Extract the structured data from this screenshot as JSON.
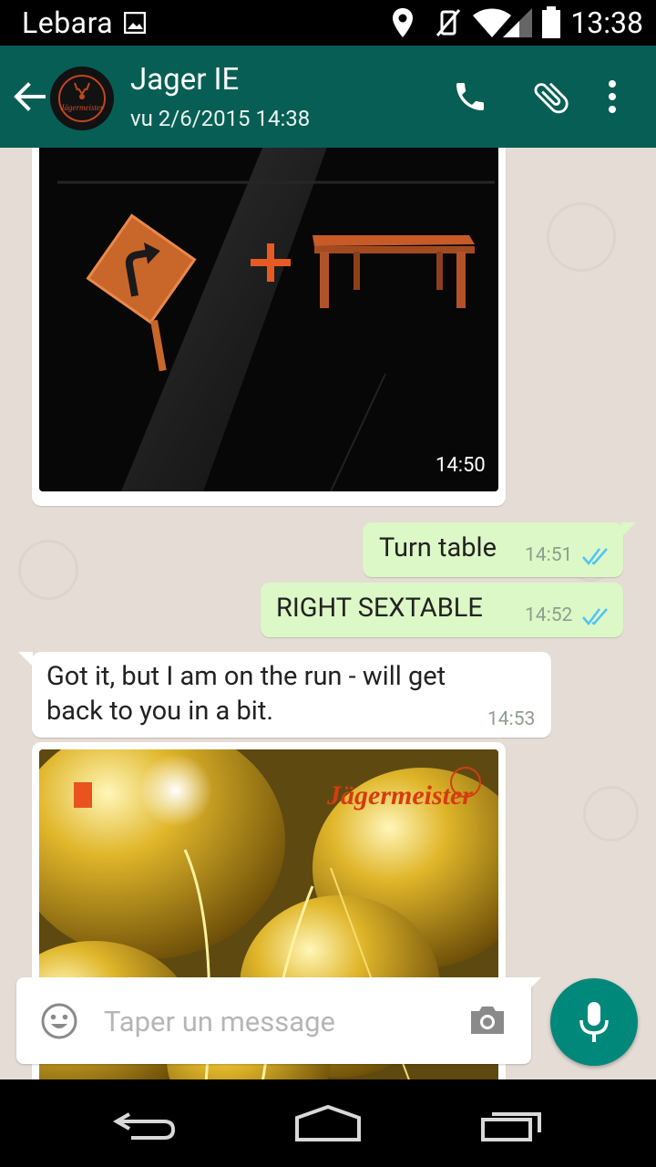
{
  "status_bar": {
    "carrier": "Lebara",
    "time": "13:38",
    "icons": [
      "image-notification-icon",
      "location-icon",
      "vibrate-mute-icon",
      "wifi-icon",
      "signal-icon",
      "battery-icon"
    ]
  },
  "header": {
    "contact_name": "Jager IE",
    "last_seen": "vu 2/6/2015 14:38",
    "avatar_text": "Jägermeister",
    "icons": [
      "back-arrow-icon",
      "phone-icon",
      "attach-icon",
      "more-vert-icon"
    ]
  },
  "messages": [
    {
      "direction": "in",
      "type": "image",
      "time": "14:50"
    },
    {
      "direction": "out",
      "type": "text",
      "text": "Turn table",
      "time": "14:51",
      "status": "read"
    },
    {
      "direction": "out",
      "type": "text",
      "text": "RIGHT SEXTABLE",
      "time": "14:52",
      "status": "read"
    },
    {
      "direction": "in",
      "type": "text",
      "text_line1": "Got it, but I am on the run - will get",
      "text_line2": "back to you in a bit.",
      "time": "14:53"
    },
    {
      "direction": "in",
      "type": "image",
      "image_text": "Jägermeister"
    }
  ],
  "input": {
    "placeholder": "Taper un message"
  },
  "colors": {
    "header": "#075e54",
    "outgoing_bubble": "#dcf8c6",
    "mic_button": "#00897b",
    "read_ticks": "#4fc3f7"
  }
}
